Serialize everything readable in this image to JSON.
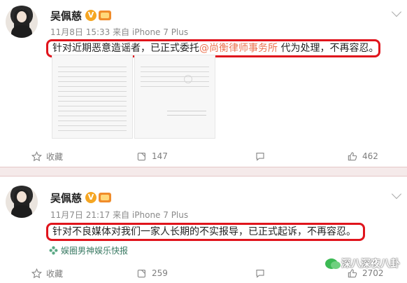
{
  "posts": [
    {
      "author": "吴佩慈",
      "verified_badge": "V",
      "meta": "11月8日 15:33 来自 iPhone 7 Plus",
      "text_before": "针对近期恶意造谣者，已正式委托",
      "mention": "@尚衡律师事务所",
      "text_after": " 代为处理，不再容忍。",
      "actions": {
        "favorite_label": "收藏",
        "repost_count": "147",
        "like_count": "462"
      }
    },
    {
      "author": "吴佩慈",
      "verified_badge": "V",
      "meta": "11月7日 21:17 来自 iPhone 7 Plus",
      "text": "针对不良媒体对我们一家人长期的不实报导，已正式起诉，不再容忍。",
      "source": "娱圈男神娱乐快报",
      "actions": {
        "favorite_label": "收藏",
        "repost_count": "259",
        "like_count": "2702"
      }
    }
  ],
  "watermark": "深八深夜八卦",
  "colors": {
    "highlight_border": "#e0141c",
    "mention": "#eb7350",
    "source": "#3a7a63"
  }
}
